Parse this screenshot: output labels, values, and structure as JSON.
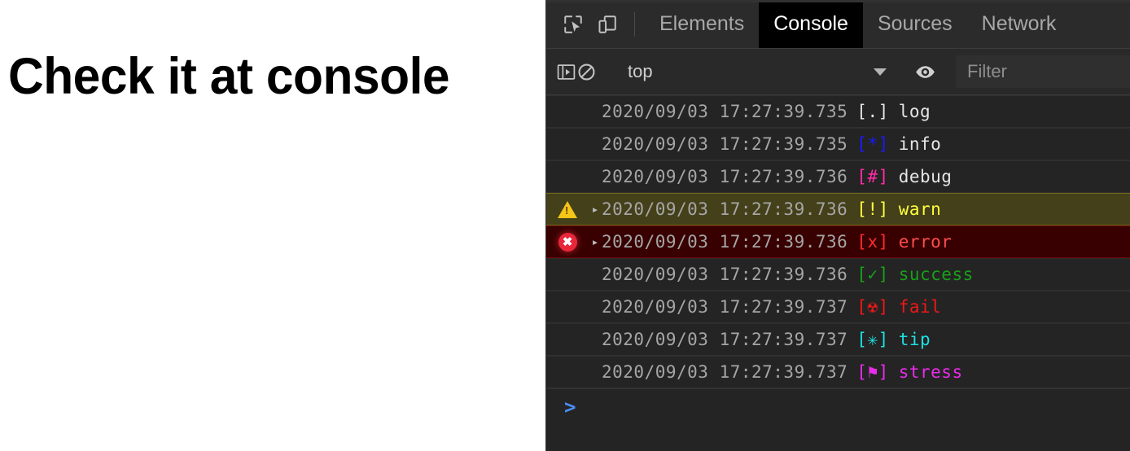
{
  "page": {
    "heading": "Check it at console",
    "background_color": "#ffffff"
  },
  "devtools": {
    "panel_background": "#242424",
    "toolbar_icons": {
      "inspect": "inspect-element-icon",
      "device": "device-toolbar-icon",
      "sidebar": "console-sidebar-icon",
      "clear": "clear-console-icon",
      "eye": "live-expression-eye-icon"
    },
    "tabs": [
      {
        "label": "Elements",
        "active": false
      },
      {
        "label": "Console",
        "active": true
      },
      {
        "label": "Sources",
        "active": false
      },
      {
        "label": "Network",
        "active": false
      }
    ],
    "console_toolbar": {
      "context": "top",
      "context_caret": "chevron-down-icon",
      "filter_placeholder": "Filter",
      "filter_value": ""
    },
    "prompt": {
      "caret": ">",
      "caret_color": "#4a8df6",
      "input_value": ""
    },
    "log_rows": [
      {
        "level": "log",
        "icon": "",
        "expandable": false,
        "timestamp": "2020/09/03 17:27:39.735",
        "mark": "[.]",
        "mark_color": "#e6e6e6",
        "message": "log",
        "message_color": "#e6e6e6",
        "row_bg": "#242424"
      },
      {
        "level": "info",
        "icon": "",
        "expandable": false,
        "timestamp": "2020/09/03 17:27:39.735",
        "mark": "[*]",
        "mark_color": "#1a1aff",
        "message": "info",
        "message_color": "#e6e6e6",
        "row_bg": "#242424"
      },
      {
        "level": "debug",
        "icon": "",
        "expandable": false,
        "timestamp": "2020/09/03 17:27:39.736",
        "mark": "[#]",
        "mark_color": "#ff2ba6",
        "message": "debug",
        "message_color": "#e6e6e6",
        "row_bg": "#242424"
      },
      {
        "level": "warn",
        "icon": "warning-triangle-icon",
        "expandable": true,
        "timestamp": "2020/09/03 17:27:39.736",
        "mark": "[!]",
        "mark_color": "#ffff3d",
        "message": "warn",
        "message_color": "#ffff3d",
        "row_bg": "#44401a"
      },
      {
        "level": "error",
        "icon": "error-circle-icon",
        "expandable": true,
        "timestamp": "2020/09/03 17:27:39.736",
        "mark": "[x]",
        "mark_color": "#ff2b2b",
        "message": "error",
        "message_color": "#ff4d4d",
        "row_bg": "#380000"
      },
      {
        "level": "success",
        "icon": "",
        "expandable": false,
        "timestamp": "2020/09/03 17:27:39.736",
        "mark": "[✓]",
        "mark_color": "#18a018",
        "message": "success",
        "message_color": "#18a018",
        "row_bg": "#242424"
      },
      {
        "level": "fail",
        "icon": "",
        "expandable": false,
        "timestamp": "2020/09/03 17:27:39.737",
        "mark": "[☢]",
        "mark_color": "#f01717",
        "message": "fail",
        "message_color": "#f01717",
        "row_bg": "#242424"
      },
      {
        "level": "tip",
        "icon": "",
        "expandable": false,
        "timestamp": "2020/09/03 17:27:39.737",
        "mark": "[✳]",
        "mark_color": "#1ee0e0",
        "message": "tip",
        "message_color": "#1ee0e0",
        "row_bg": "#242424"
      },
      {
        "level": "stress",
        "icon": "",
        "expandable": false,
        "timestamp": "2020/09/03 17:27:39.737",
        "mark": "[⚑]",
        "mark_color": "#e92ce9",
        "message": "stress",
        "message_color": "#e92ce9",
        "row_bg": "#242424"
      }
    ]
  }
}
